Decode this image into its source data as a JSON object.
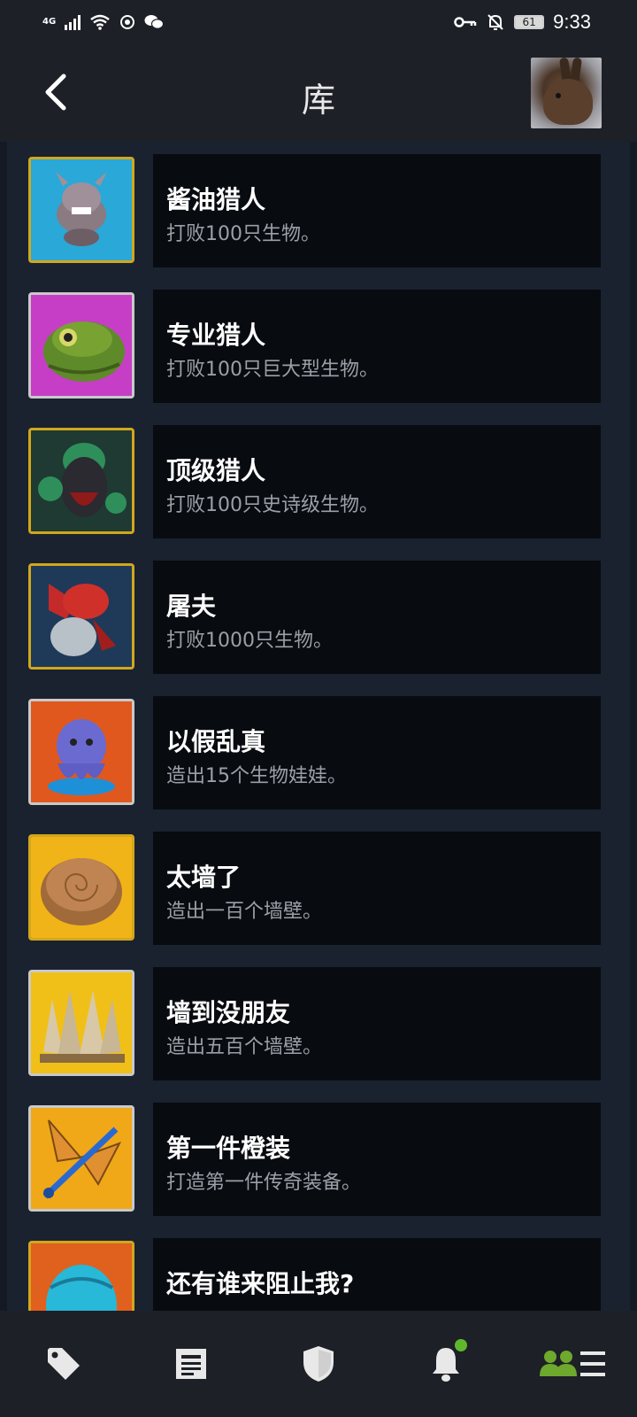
{
  "status_bar": {
    "network": "4G",
    "battery": "61",
    "time": "9:33"
  },
  "header": {
    "title": "库"
  },
  "achievements": [
    {
      "title": "酱油猎人",
      "description": "打败100只生物。",
      "icon": "hippo-creature-icon"
    },
    {
      "title": "专业猎人",
      "description": "打败100只巨大型生物。",
      "icon": "toad-creature-icon"
    },
    {
      "title": "顶级猎人",
      "description": "打败100只史诗级生物。",
      "icon": "hooded-creature-icon"
    },
    {
      "title": "屠夫",
      "description": "打败1000只生物。",
      "icon": "red-beast-icon"
    },
    {
      "title": "以假乱真",
      "description": "造出15个生物娃娃。",
      "icon": "octopus-doll-icon"
    },
    {
      "title": "太墙了",
      "description": "造出一百个墙壁。",
      "icon": "wooden-wall-icon"
    },
    {
      "title": "墙到没朋友",
      "description": "造出五百个墙壁。",
      "icon": "stone-walls-icon"
    },
    {
      "title": "第一件橙装",
      "description": "打造第一件传奇装备。",
      "icon": "butterfly-sword-icon"
    },
    {
      "title": "还有谁来阻止我?",
      "description": "",
      "icon": "blue-helmet-icon"
    }
  ],
  "bottom_nav": [
    {
      "name": "tag-icon"
    },
    {
      "name": "news-icon"
    },
    {
      "name": "shield-icon"
    },
    {
      "name": "bell-icon"
    },
    {
      "name": "friends-menu-icon"
    }
  ],
  "colors": {
    "accent_green": "#5fb82c",
    "gold_frame": "#d1a71c",
    "card_bg": "#080b10"
  }
}
